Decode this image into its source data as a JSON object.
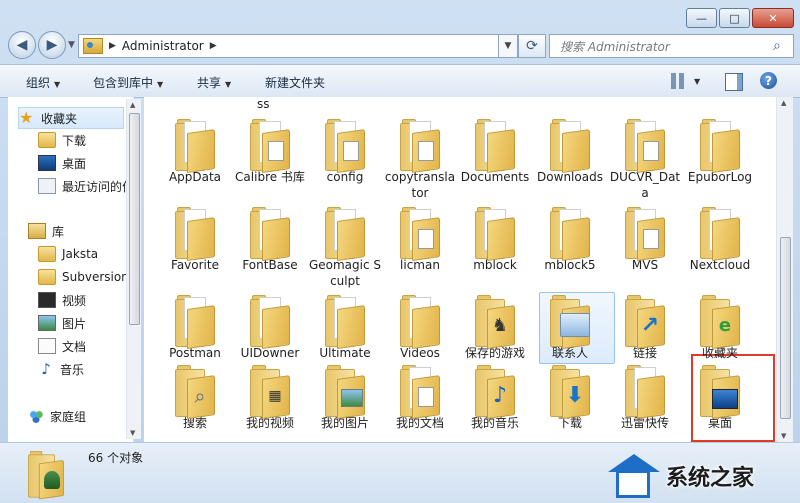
{
  "window": {
    "min": "—",
    "max": "□",
    "close": "✕"
  },
  "address": {
    "segment": "Administrator",
    "search_placeholder": "搜索 Administrator"
  },
  "toolbar": {
    "organize": "组织",
    "include": "包含到库中",
    "share": "共享",
    "new_folder": "新建文件夹",
    "help": "?"
  },
  "sidebar": {
    "favorites": "收藏夹",
    "downloads": "下载",
    "desktop": "桌面",
    "recent": "最近访问的位",
    "libraries": "库",
    "jaksta": "Jaksta",
    "subversion": "Subversion",
    "videos": "视频",
    "pictures": "图片",
    "documents": "文档",
    "music": "音乐",
    "homegroup": "家庭组"
  },
  "content": {
    "top_clip": "ss",
    "items": [
      {
        "label": "AppData",
        "overlay": ""
      },
      {
        "label": "Calibre 书库",
        "overlay": "doc"
      },
      {
        "label": "config",
        "overlay": "doc"
      },
      {
        "label": "copytranslator",
        "overlay": "doc"
      },
      {
        "label": "Documents",
        "overlay": ""
      },
      {
        "label": "Downloads",
        "overlay": ""
      },
      {
        "label": "DUCVR_Data",
        "overlay": "doc"
      },
      {
        "label": "EpuborLog",
        "overlay": ""
      },
      {
        "label": "Favorite",
        "overlay": ""
      },
      {
        "label": "FontBase",
        "overlay": ""
      },
      {
        "label": "Geomagic Sculpt",
        "overlay": ""
      },
      {
        "label": "licman",
        "overlay": "doc"
      },
      {
        "label": "mblock",
        "overlay": ""
      },
      {
        "label": "mblock5",
        "overlay": ""
      },
      {
        "label": "MVS",
        "overlay": "doc"
      },
      {
        "label": "Nextcloud",
        "overlay": ""
      },
      {
        "label": "Postman",
        "overlay": ""
      },
      {
        "label": "UIDowner",
        "overlay": ""
      },
      {
        "label": "Ultimate",
        "overlay": ""
      },
      {
        "label": "Videos",
        "overlay": ""
      },
      {
        "label": "保存的游戏",
        "overlay": "game"
      },
      {
        "label": "联系人",
        "overlay": "contact"
      },
      {
        "label": "链接",
        "overlay": "link"
      },
      {
        "label": "收藏夹",
        "overlay": "fav"
      },
      {
        "label": "搜索",
        "overlay": "search"
      },
      {
        "label": "我的视频",
        "overlay": "video"
      },
      {
        "label": "我的图片",
        "overlay": "pic"
      },
      {
        "label": "我的文档",
        "overlay": "doc"
      },
      {
        "label": "我的音乐",
        "overlay": "music"
      },
      {
        "label": "下载",
        "overlay": "dl"
      },
      {
        "label": "迅雷快传",
        "overlay": ""
      },
      {
        "label": "桌面",
        "overlay": "desk"
      }
    ]
  },
  "status": {
    "count": "66 个对象"
  },
  "watermark": {
    "text": "系统之家"
  }
}
